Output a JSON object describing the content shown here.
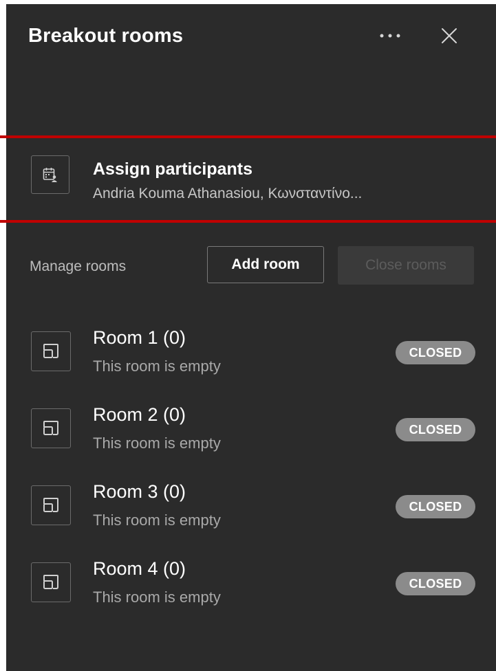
{
  "header": {
    "title": "Breakout rooms",
    "more_icon": "more-horizontal-icon",
    "close_icon": "close-icon"
  },
  "assign": {
    "icon": "assign-participants-icon",
    "title": "Assign participants",
    "subtitle": "Andria Kouma Athanasiou, Κωνσταντίνο..."
  },
  "manage": {
    "label": "Manage rooms",
    "add_room_label": "Add room",
    "close_rooms_label": "Close rooms"
  },
  "rooms": [
    {
      "name": "Room 1 (0)",
      "status": "This room is empty",
      "badge": "CLOSED",
      "icon": "room-icon"
    },
    {
      "name": "Room 2 (0)",
      "status": "This room is empty",
      "badge": "CLOSED",
      "icon": "room-icon"
    },
    {
      "name": "Room 3 (0)",
      "status": "This room is empty",
      "badge": "CLOSED",
      "icon": "room-icon"
    },
    {
      "name": "Room 4 (0)",
      "status": "This room is empty",
      "badge": "CLOSED",
      "icon": "room-icon"
    }
  ],
  "colors": {
    "panel_background": "#2b2b2b",
    "highlight": "#c00000",
    "badge_background": "#8b8b8b"
  }
}
